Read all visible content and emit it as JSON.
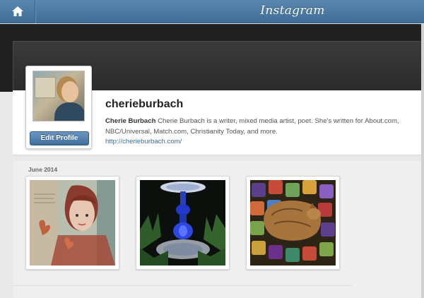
{
  "header": {
    "brand": "Instagram",
    "home_icon": "home-icon"
  },
  "profile": {
    "username": "cherieburbach",
    "display_name": "Cherie Burbach",
    "bio": "Cherie Burbach is a writer, mixed media artist, poet. She's written for About.com, NBC/Universal, Match.com, Christianity Today, and more.",
    "website": "http://cherieburbach.com/",
    "edit_button": "Edit Profile"
  },
  "photos": {
    "month_label": "June 2014",
    "items": [
      {
        "subject": "mixed media portrait of a woman"
      },
      {
        "subject": "blue glass garden totem at night"
      },
      {
        "subject": "cat on a crocheted granny-square blanket"
      }
    ]
  },
  "colors": {
    "header_blue": "#3f6d97",
    "link": "#3b6b9a",
    "button_blue": "#4f7fae"
  }
}
